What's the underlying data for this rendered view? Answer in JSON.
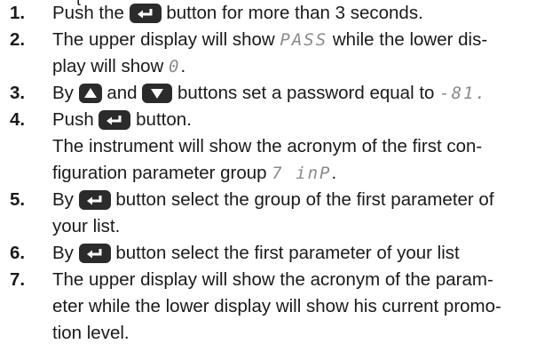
{
  "top_fragment": "t",
  "steps": [
    {
      "number": "1.",
      "pre": "Push the",
      "icon": "enter-icon",
      "post": "button for more than 3 seconds."
    },
    {
      "number": "2.",
      "line1_pre": "The upper display will show",
      "display_pass": "PASS",
      "line1_post": "while the lower dis-",
      "line2_pre": "play will show",
      "display_zero": "0",
      "line2_post": "."
    },
    {
      "number": "3.",
      "pre": "By",
      "icon_up": "up-arrow-icon",
      "mid": "and",
      "icon_down": "down-arrow-icon",
      "post": "buttons set a password equal to",
      "display_code": "-81."
    },
    {
      "number": "4.",
      "pre": "Push",
      "icon": "enter-icon",
      "post": "button.",
      "line2": "The instrument will show the acronym of the first con-",
      "line3_pre": "figuration parameter group",
      "display_group": "7 inP",
      "line3_post": "."
    },
    {
      "number": "5.",
      "line1_pre": "By",
      "icon": "enter-icon",
      "line1_post": "button select the group of the first parameter of",
      "line2": "your list."
    },
    {
      "number": "6.",
      "pre": "By",
      "icon": "enter-icon",
      "post": "button select the first parameter of your list"
    },
    {
      "number": "7.",
      "line1": "The upper display will show the acronym of the param-",
      "line2": "eter  while the lower display will show his current promo-",
      "line3": "tion level."
    }
  ],
  "colors": {
    "text": "#1a1a1a",
    "button_bg": "#2b2b2b",
    "display_digits": "#8a8a8a"
  }
}
